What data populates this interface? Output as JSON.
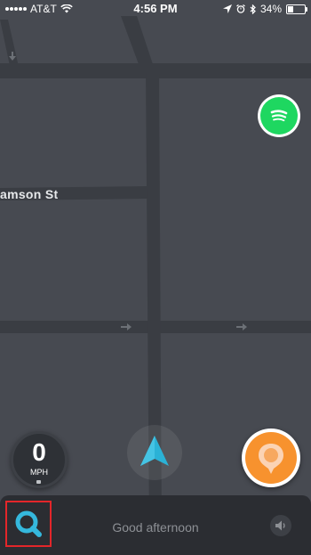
{
  "status_bar": {
    "carrier": "AT&T",
    "time": "4:56 PM",
    "battery_percent": "34%",
    "battery_level": 0.34,
    "icons": [
      "signal-dots",
      "wifi-icon",
      "location-arrow-icon",
      "alarm-icon",
      "bluetooth-icon",
      "battery-icon"
    ]
  },
  "map": {
    "street_label": "amson St",
    "colors": {
      "background": "#474a51",
      "road": "#3a3d43"
    }
  },
  "spotify": {
    "icon": "spotify-icon",
    "color": "#1ed760"
  },
  "speedometer": {
    "value": "0",
    "unit": "MPH"
  },
  "location_marker": {
    "icon": "navigation-arrow-icon",
    "color": "#2bb2d6"
  },
  "report_button": {
    "icon": "report-pin-icon",
    "color": "#f7922e"
  },
  "bottom_bar": {
    "greeting": "Good afternoon",
    "search_icon": "search-icon",
    "sound_icon": "speaker-icon",
    "highlight_color": "#e3262a"
  }
}
